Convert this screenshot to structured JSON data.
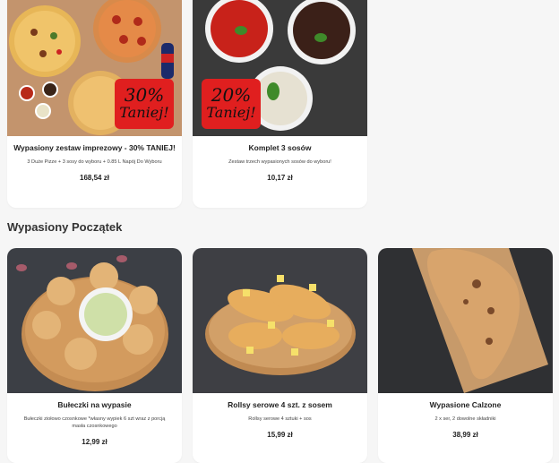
{
  "promotions": [
    {
      "title": "Wypasiony zestaw imprezowy - 30% TANIEJ!",
      "description": "3 Duże Pizze + 3 sosy do wyboru + 0.85 L Napój Do Wyboru",
      "price": "168,54 zł",
      "badge_percent": "30%",
      "badge_text": "Taniej!"
    },
    {
      "title": "Komplet 3 sosów",
      "description": "Zestaw trzech wypasionych sosów do wyboru!",
      "price": "10,17 zł",
      "badge_percent": "20%",
      "badge_text": "Taniej!"
    }
  ],
  "section": {
    "title": "Wypasiony Początek"
  },
  "products": [
    {
      "title": "Bułeczki na wypasie",
      "description": "Bułeczki ziołowo czosnkowe *własny wypiek 6 szt wraz z porcją masła czosnkowego",
      "price": "12,99 zł"
    },
    {
      "title": "Rollsy serowe 4 szt. z sosem",
      "description": "Rollsy serowe 4 sztuki + sos",
      "price": "15,99 zł"
    },
    {
      "title": "Wypasione Calzone",
      "description": "2 x ser, 2 dowolne składniki",
      "price": "38,99 zł"
    }
  ],
  "colors": {
    "badge_red": "#e01f1f",
    "background": "#f6f6f6",
    "card": "#ffffff"
  }
}
